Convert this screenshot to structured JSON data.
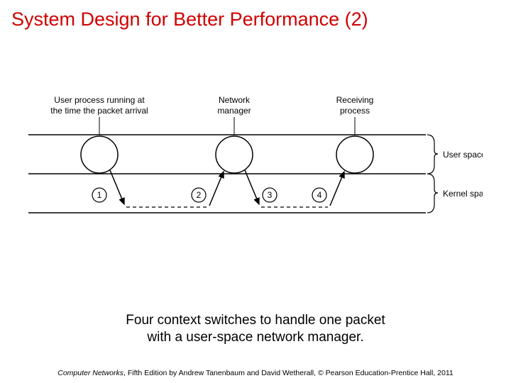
{
  "title": "System Design for Better Performance (2)",
  "diagram": {
    "labels": {
      "user_process_l1": "User process running at",
      "user_process_l2": "the time the packet arrival",
      "network_manager_l1": "Network",
      "network_manager_l2": "manager",
      "receiving_l1": "Receiving",
      "receiving_l2": "process",
      "user_space": "User space",
      "kernel_space": "Kernel space"
    },
    "step1": "1",
    "step2": "2",
    "step3": "3",
    "step4": "4"
  },
  "caption_l1": "Four context switches to handle one packet",
  "caption_l2": "with a user-space network manager.",
  "footer_book": "Computer Networks",
  "footer_rest": ", Fifth Edition by Andrew Tanenbaum and David Wetherall, © Pearson Education-Prentice Hall, 2011"
}
